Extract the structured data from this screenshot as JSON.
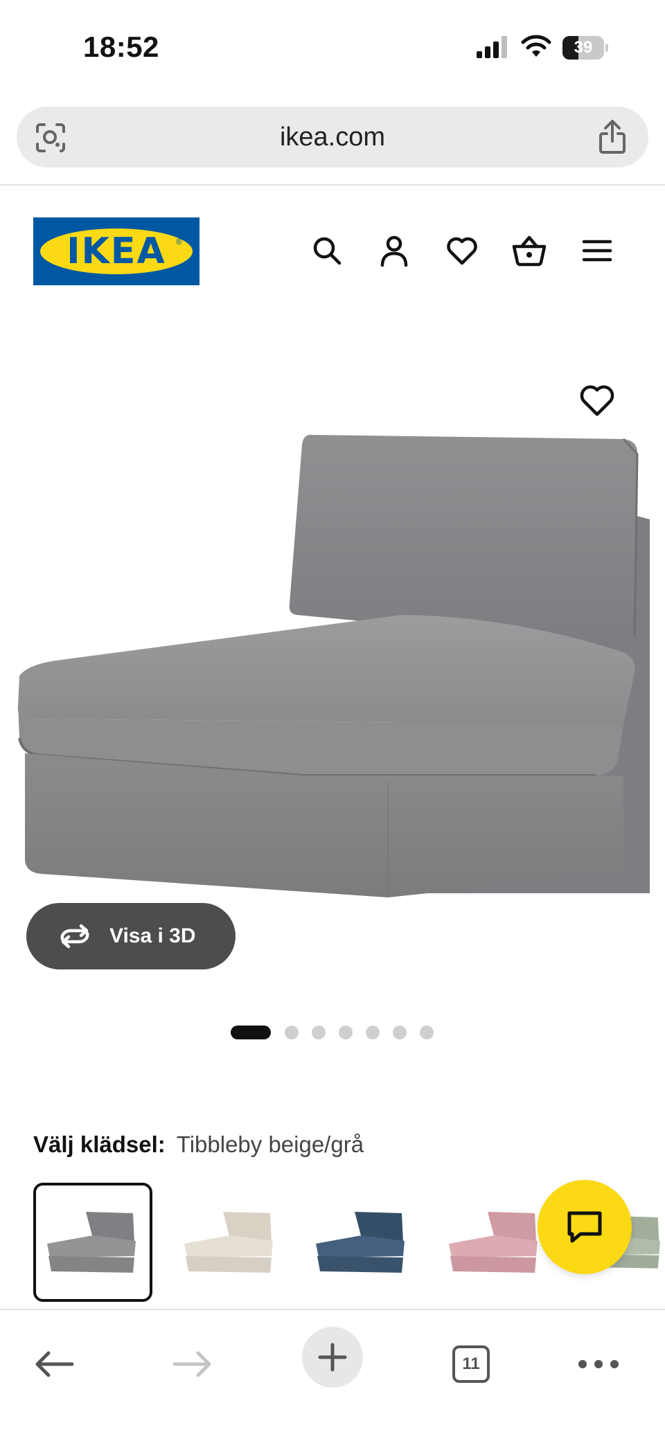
{
  "status_bar": {
    "time": "18:52",
    "battery": "39",
    "battery_level": 0.39
  },
  "browser": {
    "url": "ikea.com",
    "tabs_count": "11"
  },
  "header": {
    "logo_text": "IKEA",
    "logo_reg": "®"
  },
  "product": {
    "view_3d_label": "Visa i 3D",
    "image_count": 7,
    "active_image": 1
  },
  "fabric": {
    "label": "Välj klädsel:",
    "selected": "Tibbleby beige/grå",
    "swatch_colors": [
      "#8c8d8f",
      "#e3ddd2",
      "#3e5874",
      "#d7a6ad",
      "#aab5a4"
    ]
  },
  "colors": {
    "ikea_blue": "#0058a3",
    "ikea_yellow": "#fbd914",
    "button_dark": "#4d4d4d"
  }
}
